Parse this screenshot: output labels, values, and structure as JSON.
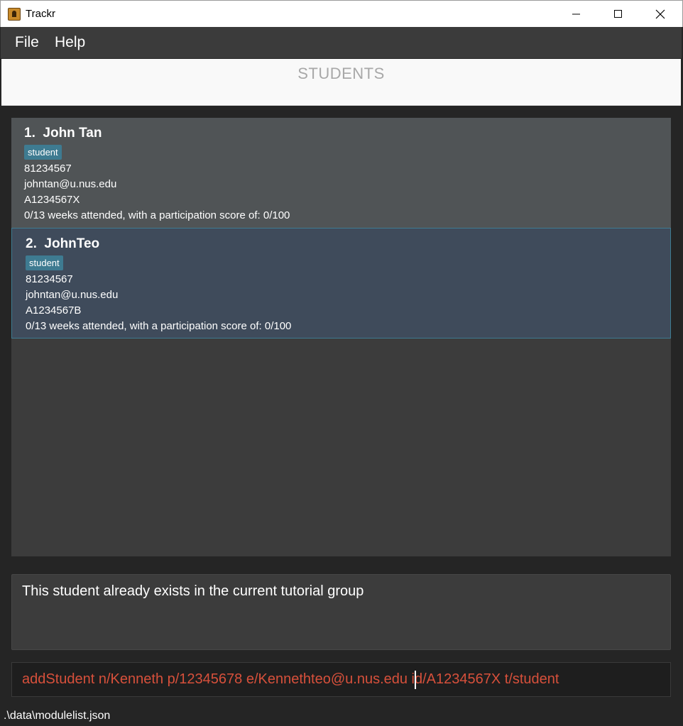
{
  "window": {
    "title": "Trackr",
    "icon": "contact-book-icon"
  },
  "menu": {
    "file_label": "File",
    "help_label": "Help"
  },
  "header": {
    "title": "STUDENTS"
  },
  "students": [
    {
      "index_name": "1.  John Tan",
      "tag": "student",
      "phone": "81234567",
      "email": "johntan@u.nus.edu",
      "student_id": "A1234567X",
      "attendance": "0/13 weeks attended, with a participation score of: 0/100"
    },
    {
      "index_name": "2.  JohnTeo",
      "tag": "student",
      "phone": "81234567",
      "email": "johntan@u.nus.edu",
      "student_id": "A1234567B",
      "attendance": "0/13 weeks attended, with a participation score of: 0/100"
    }
  ],
  "result": {
    "message": "This student already exists in the current tutorial group"
  },
  "command": {
    "value": "addStudent n/Kenneth p/12345678 e/Kennethteo@u.nus.edu id/A1234567X t/student"
  },
  "status": {
    "path": ".\\data\\modulelist.json"
  },
  "colors": {
    "accent": "#3e7b91",
    "command_text": "#d7503b",
    "selected_card": "#3f4b5b"
  }
}
